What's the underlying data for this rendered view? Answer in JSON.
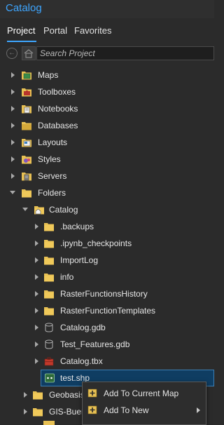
{
  "pane": {
    "title": "Catalog"
  },
  "tabs": [
    {
      "label": "Project",
      "active": true
    },
    {
      "label": "Portal",
      "active": false
    },
    {
      "label": "Favorites",
      "active": false
    }
  ],
  "search": {
    "placeholder": "Search Project",
    "value": ""
  },
  "tree": {
    "maps": "Maps",
    "toolboxes": "Toolboxes",
    "notebooks": "Notebooks",
    "databases": "Databases",
    "layouts": "Layouts",
    "styles": "Styles",
    "servers": "Servers",
    "folders": "Folders",
    "catalog": "Catalog",
    "items": [
      ".backups",
      ".ipynb_checkpoints",
      "ImportLog",
      "info",
      "RasterFunctionsHistory",
      "RasterFunctionTemplates",
      "Catalog.gdb",
      "Test_Features.gdb",
      "Catalog.tbx",
      "test.shp"
    ],
    "geobasis_partial": "Geobasis",
    "gisbuero_partial": "GIS-Buer"
  },
  "context_menu": {
    "add_to_current_map": "Add To Current Map",
    "add_to_new": "Add To New"
  },
  "colors": {
    "accent": "#3ea6ff",
    "folder": "#e8c154",
    "selection": "#0f3d62"
  }
}
